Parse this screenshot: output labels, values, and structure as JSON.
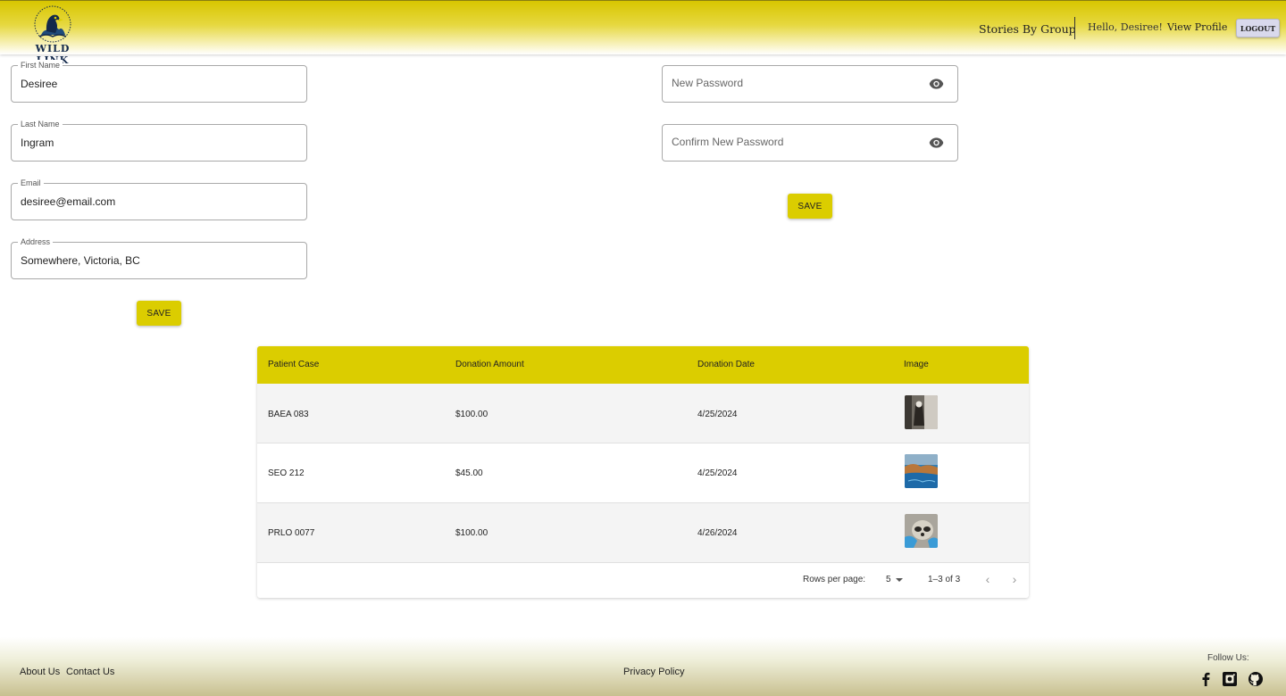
{
  "header": {
    "logo_text": "WILD LINK",
    "nav_stories": "Stories By Group",
    "greeting": "Hello, Desiree!",
    "view_profile": "View Profile",
    "logout": "LOGOUT"
  },
  "profile_form": {
    "first_name": {
      "label": "First Name",
      "value": "Desiree"
    },
    "last_name": {
      "label": "Last Name",
      "value": "Ingram"
    },
    "email": {
      "label": "Email",
      "value": "desiree@email.com"
    },
    "address": {
      "label": "Address",
      "value": "Somewhere, Victoria, BC"
    },
    "save_label": "SAVE"
  },
  "password_form": {
    "new_password_placeholder": "New Password",
    "confirm_password_placeholder": "Confirm New Password",
    "save_label": "SAVE"
  },
  "donations_table": {
    "headers": [
      "Patient Case",
      "Donation Amount",
      "Donation Date",
      "Image"
    ],
    "rows": [
      {
        "case": "BAEA 083",
        "amount": "$100.00",
        "date": "4/25/2024",
        "image": "eagle-thumbnail"
      },
      {
        "case": "SEO 212",
        "amount": "$45.00",
        "date": "4/25/2024",
        "image": "otter-in-water-thumbnail"
      },
      {
        "case": "PRLO 0077",
        "amount": "$100.00",
        "date": "4/26/2024",
        "image": "raccoon-thumbnail"
      }
    ],
    "pagination": {
      "rows_per_page_label": "Rows per page:",
      "rows_per_page_value": "5",
      "range_text": "1–3 of 3"
    }
  },
  "footer": {
    "about": "About Us",
    "contact": "Contact Us",
    "privacy": "Privacy Policy",
    "follow": "Follow Us:",
    "social_icons": [
      "facebook-icon",
      "instagram-icon",
      "github-icon"
    ]
  },
  "colors": {
    "accent_yellow": "#dbcd00",
    "logo_navy": "#13294b"
  }
}
